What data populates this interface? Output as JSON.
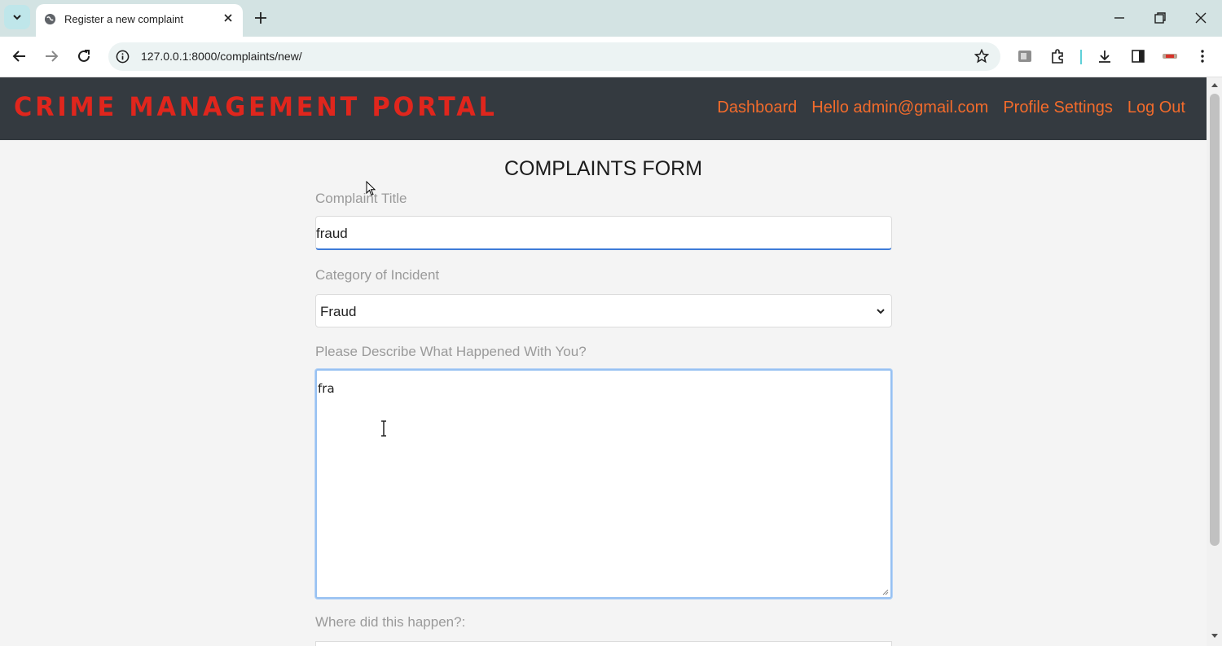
{
  "browser": {
    "tab_title": "Register a new complaint",
    "url": "127.0.0.1:8000/complaints/new/"
  },
  "navbar": {
    "brand": "CRIME MANAGEMENT PORTAL",
    "links": {
      "dashboard": "Dashboard",
      "hello": "Hello admin@gmail.com",
      "profile": "Profile Settings",
      "logout": "Log Out"
    },
    "background": "#343a40",
    "brand_color": "#e0261d",
    "link_color": "#f36b2b"
  },
  "form": {
    "heading": "COMPLAINTS FORM",
    "title_label": "Complaint Title",
    "title_value": "fraud",
    "category_label": "Category of Incident",
    "category_value": "Fraud",
    "description_label": "Please Describe What Happened With You?",
    "description_value": "fra",
    "location_label": "Where did this happen?:"
  }
}
